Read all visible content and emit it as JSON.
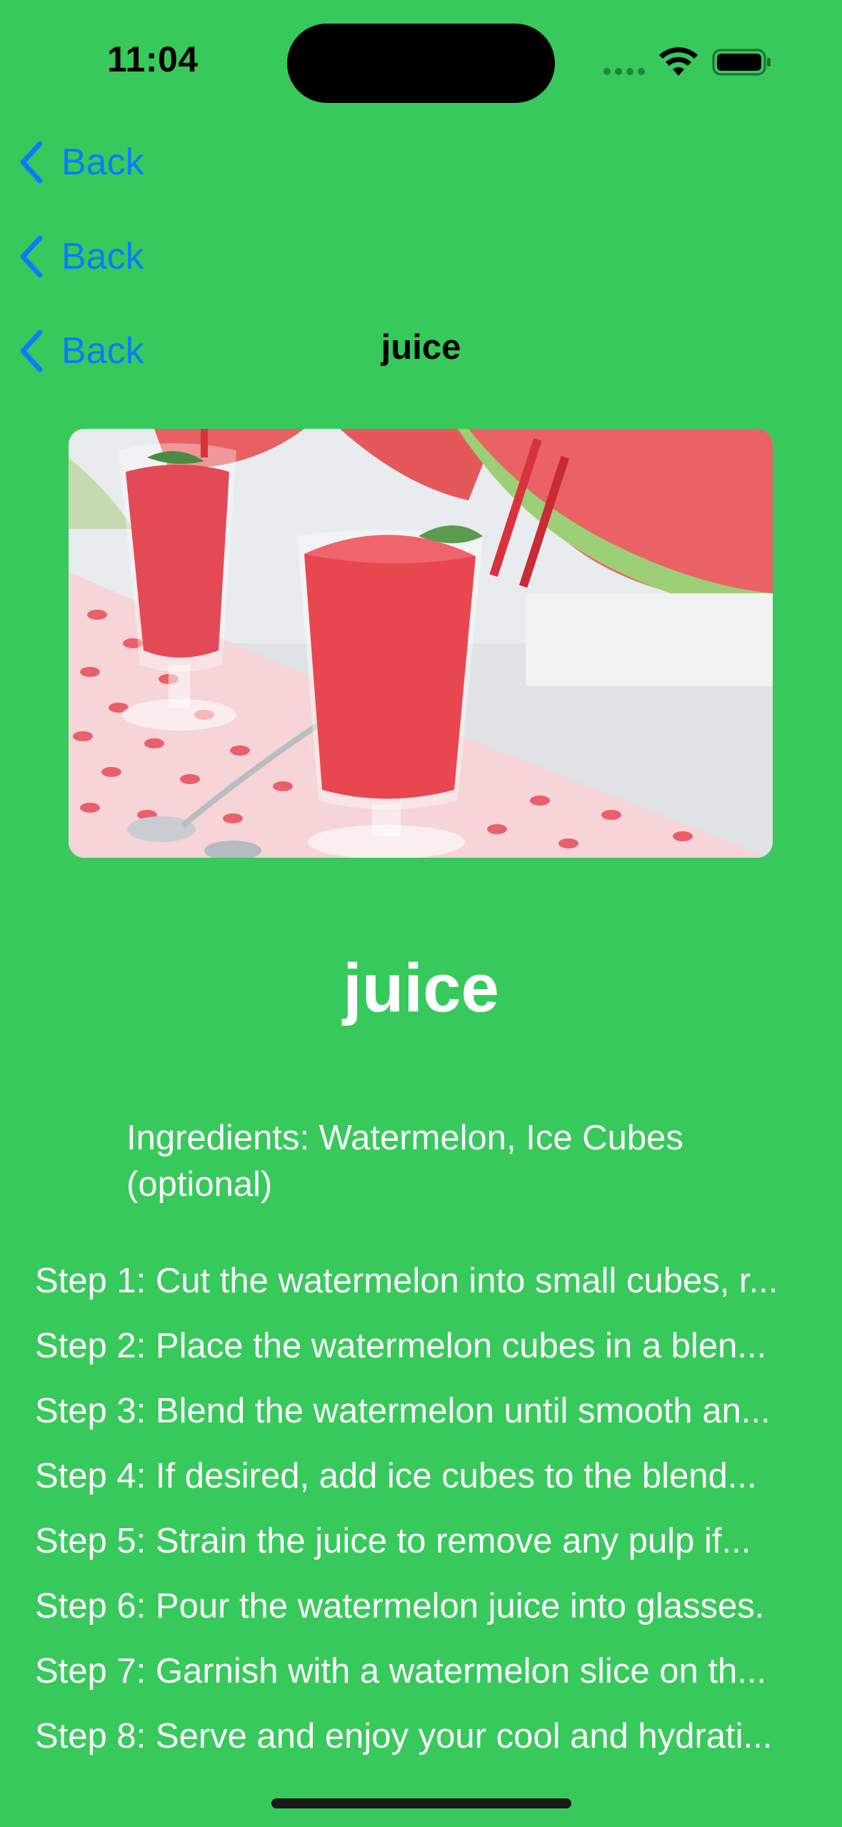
{
  "status_bar": {
    "time": "11:04"
  },
  "nav": {
    "back_buttons": [
      "Back",
      "Back",
      "Back"
    ],
    "title": "juice"
  },
  "recipe": {
    "title": "juice",
    "ingredients": "Ingredients: Watermelon, Ice Cubes (optional)",
    "steps": [
      "Step 1: Cut the watermelon into small cubes, r...",
      "Step 2: Place the watermelon cubes in a blen...",
      "Step 3: Blend the watermelon until smooth an...",
      "Step 4: If desired, add ice cubes to the blend...",
      "Step 5: Strain the juice to remove any pulp if...",
      "Step 6: Pour the watermelon juice into glasses.",
      "Step 7: Garnish with a watermelon slice on th...",
      "Step 8: Serve and enjoy your cool and hydrati..."
    ]
  },
  "colors": {
    "background": "#37c95b",
    "link": "#0a7cff",
    "text": "#ffffff"
  },
  "icons": {
    "back": "chevron-left-icon",
    "wifi": "wifi-icon",
    "battery": "battery-icon",
    "cellular": "cellular-icon"
  }
}
